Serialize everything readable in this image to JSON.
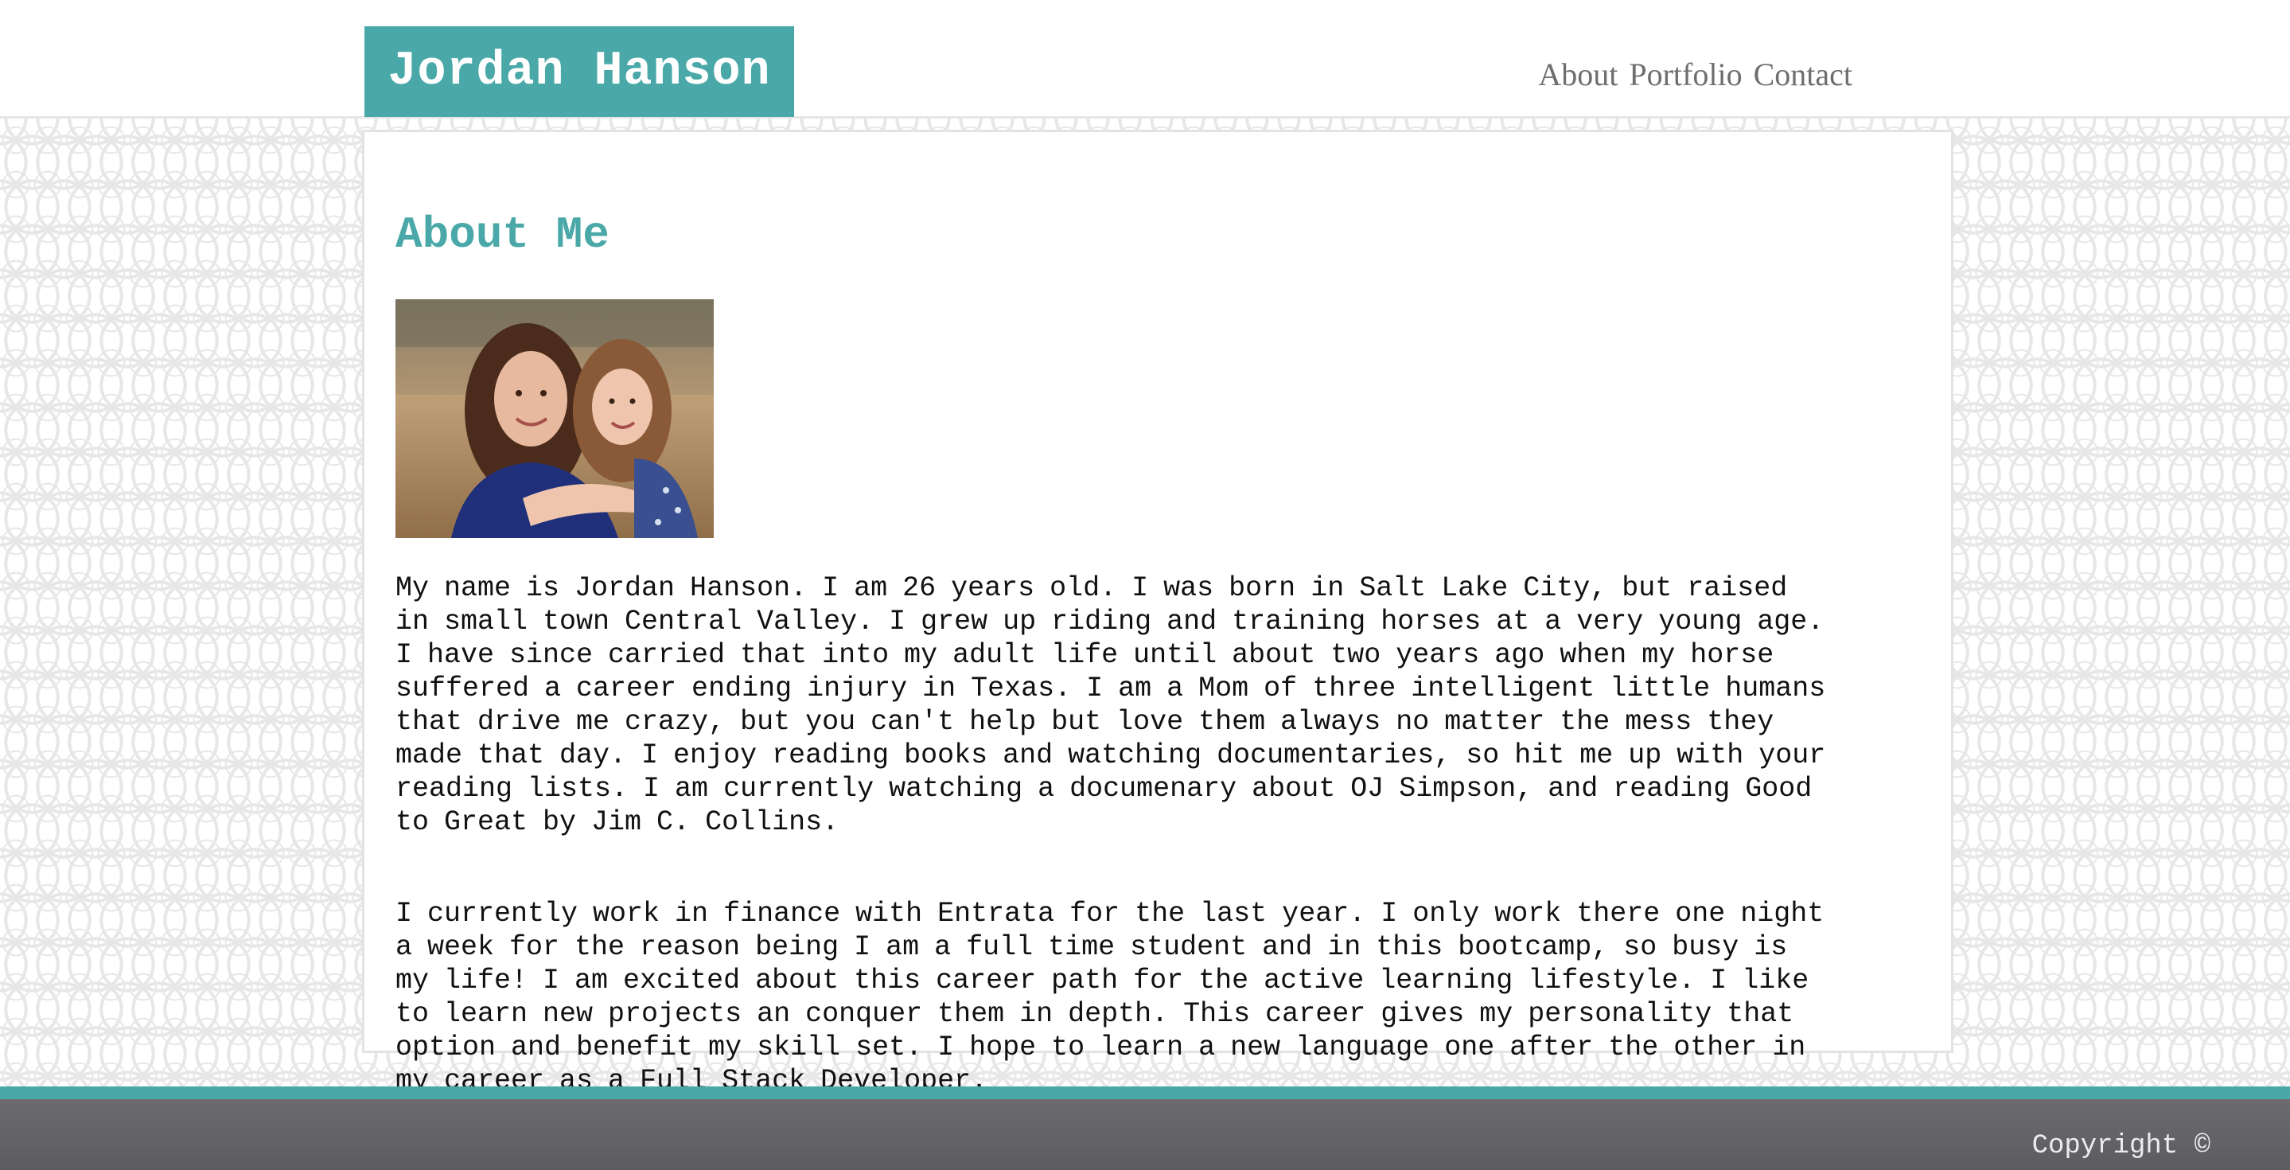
{
  "header": {
    "brand": "Jordan Hanson",
    "nav": [
      {
        "label": "About"
      },
      {
        "label": "Portfolio"
      },
      {
        "label": "Contact"
      }
    ]
  },
  "main": {
    "title": "About Me",
    "photo_alt": "Portrait of a woman and a young girl outdoors",
    "paragraphs": [
      "My name is Jordan Hanson. I am 26 years old. I was born in Salt Lake City, but raised in small town Central Valley. I grew up riding and training horses at a very young age. I have since carried that into my adult life until about two years ago when my horse suffered a career ending injury in Texas. I am a Mom of three intelligent little humans that drive me crazy, but you can't help but love them always no matter the mess they made that day. I enjoy reading books and watching documentaries, so hit me up with your reading lists. I am currently watching a documenary about OJ Simpson, and reading Good to Great by Jim C. Collins.",
      "I currently work in finance with Entrata for the last year. I only work there one night a week for the reason being I am a full time student and in this bootcamp, so busy is my life! I am excited about this career path for the active learning lifestyle. I like to learn new projects an conquer them in depth. This career gives my personality that option and benefit my skill set. I hope to learn a new language one after the other in my career as a Full Stack Developer."
    ]
  },
  "footer": {
    "copyright": "Copyright ©"
  },
  "colors": {
    "accent": "#4aa9a8",
    "nav_text": "#6e6e6e",
    "footer_bg": "#636367"
  }
}
